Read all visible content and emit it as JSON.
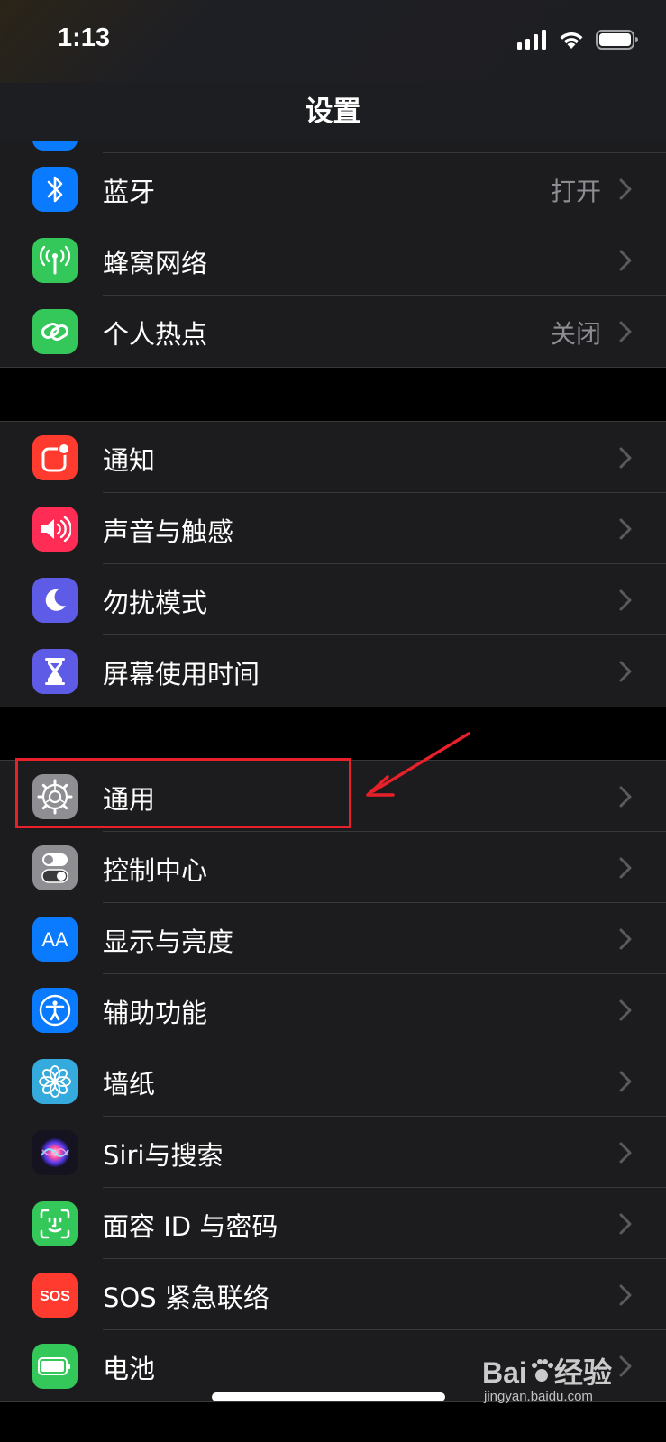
{
  "status_bar": {
    "time": "1:13"
  },
  "nav": {
    "title": "设置"
  },
  "groups": [
    {
      "items": [
        {
          "label": "蓝牙",
          "value": "打开",
          "icon": "bluetooth-icon",
          "color": "#0a7aff"
        },
        {
          "label": "蜂窝网络",
          "value": "",
          "icon": "cellular-antenna-icon",
          "color": "#34c759"
        },
        {
          "label": "个人热点",
          "value": "关闭",
          "icon": "hotspot-chain-icon",
          "color": "#34c759"
        }
      ]
    },
    {
      "items": [
        {
          "label": "通知",
          "icon": "notifications-icon",
          "color": "#ff3b30"
        },
        {
          "label": "声音与触感",
          "icon": "speaker-icon",
          "color": "#ff2d55"
        },
        {
          "label": "勿扰模式",
          "icon": "moon-icon",
          "color": "#5e5ce6"
        },
        {
          "label": "屏幕使用时间",
          "icon": "hourglass-icon",
          "color": "#5e5ce6"
        }
      ]
    },
    {
      "items": [
        {
          "label": "通用",
          "icon": "gear-icon",
          "color": "#8e8e93"
        },
        {
          "label": "控制中心",
          "icon": "toggles-icon",
          "color": "#8e8e93"
        },
        {
          "label": "显示与亮度",
          "icon": "text-size-icon",
          "color": "#0a7aff",
          "icon_text": "AA"
        },
        {
          "label": "辅助功能",
          "icon": "accessibility-icon",
          "color": "#0a7aff"
        },
        {
          "label": "墙纸",
          "icon": "flower-icon",
          "color": "#35aadc"
        },
        {
          "label": "Siri与搜索",
          "icon": "siri-icon",
          "color": "#1c1c2e"
        },
        {
          "label": "面容 ID 与密码",
          "icon": "face-id-icon",
          "color": "#34c759"
        },
        {
          "label": "SOS 紧急联络",
          "icon": "sos-icon",
          "color": "#ff3b30",
          "icon_text": "SOS"
        },
        {
          "label": "电池",
          "icon": "battery-icon",
          "color": "#34c759"
        }
      ]
    }
  ],
  "watermark": {
    "brand": "Bai",
    "brand_suffix": "经验",
    "site": "jingyan.baidu.com"
  }
}
